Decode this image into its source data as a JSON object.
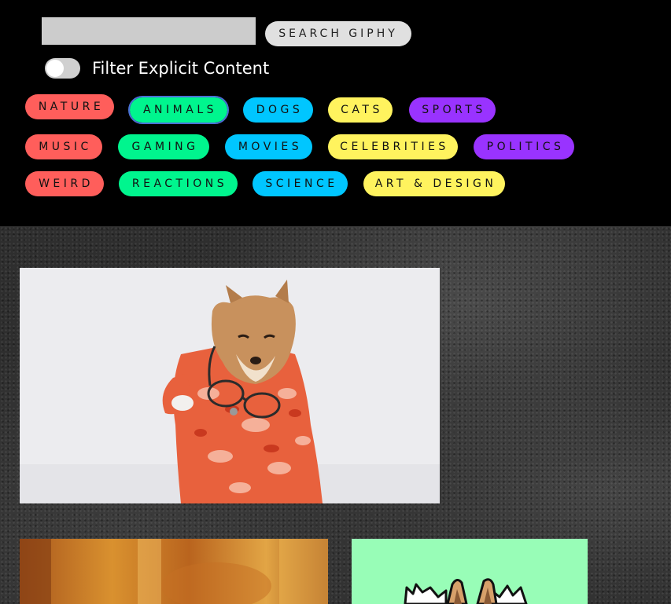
{
  "search": {
    "value": "",
    "placeholder": "",
    "button_label": "SEARCH GIPHY"
  },
  "filter": {
    "label": "Filter Explicit Content",
    "enabled": false
  },
  "categories": [
    {
      "label": "NATURE",
      "color": "#ff5e5b"
    },
    {
      "label": "ANIMALS",
      "color": "#00f58e",
      "selected": true
    },
    {
      "label": "DOGS",
      "color": "#00c6ff"
    },
    {
      "label": "CATS",
      "color": "#fff35e"
    },
    {
      "label": "SPORTS",
      "color": "#9933ff"
    },
    {
      "label": "MUSIC",
      "color": "#ff5e5b"
    },
    {
      "label": "GAMING",
      "color": "#00f58e"
    },
    {
      "label": "MOVIES",
      "color": "#00c6ff"
    },
    {
      "label": "CELEBRITIES",
      "color": "#fff35e"
    },
    {
      "label": "POLITICS",
      "color": "#9933ff"
    },
    {
      "label": "WEIRD",
      "color": "#ff5e5b"
    },
    {
      "label": "REACTIONS",
      "color": "#00f58e"
    },
    {
      "label": "SCIENCE",
      "color": "#00c6ff"
    },
    {
      "label": "ART & DESIGN",
      "color": "#fff35e"
    }
  ],
  "gifs": [
    {
      "subject": "shiba-dog-in-hawaiian-shirt",
      "background": "#ececef"
    },
    {
      "subject": "warm-blurry-scene",
      "background": "#c8761e"
    },
    {
      "subject": "cartoon-cat-on-mint",
      "background": "#98fdb7"
    }
  ]
}
